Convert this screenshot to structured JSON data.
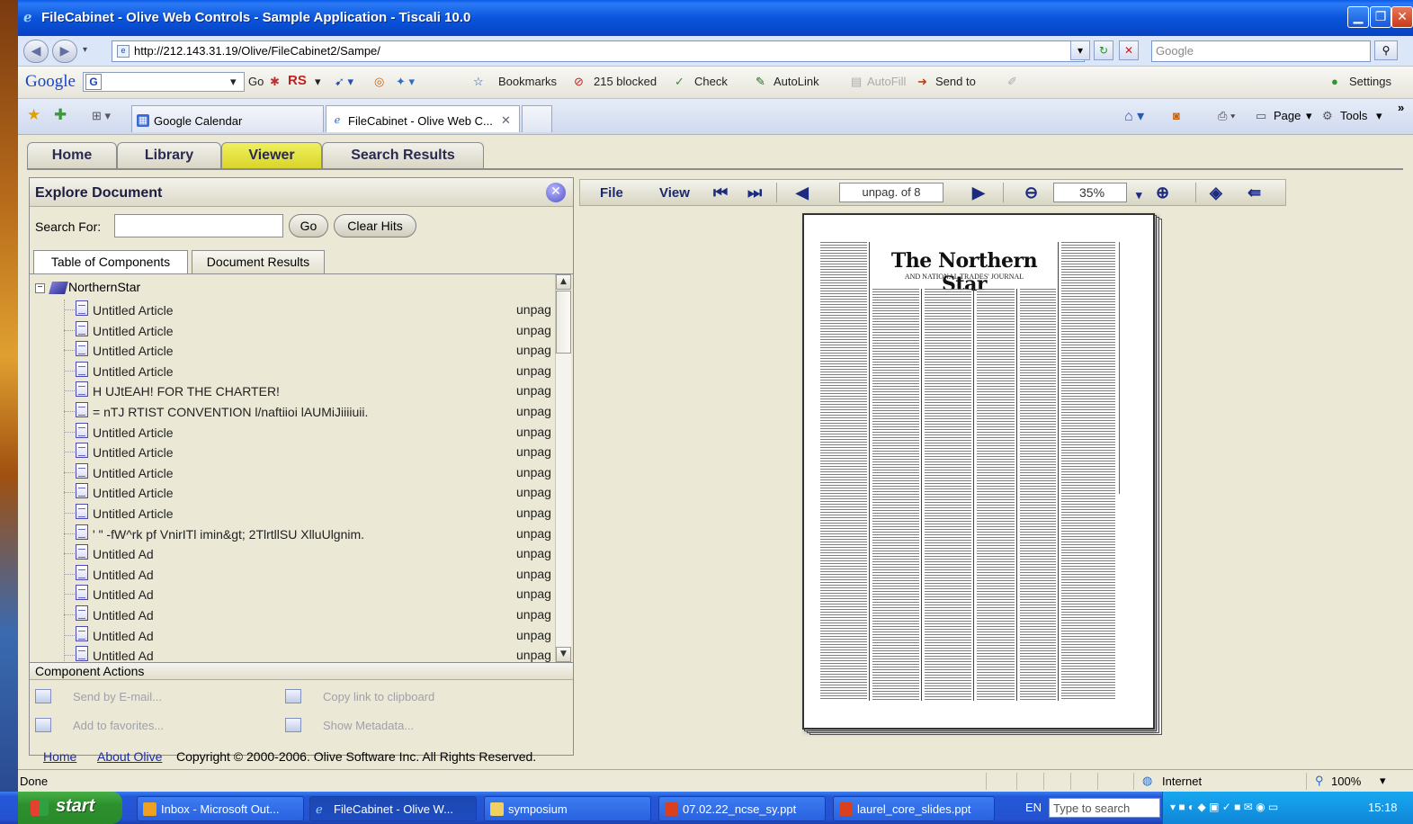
{
  "window": {
    "title": "FileCabinet - Olive Web Controls - Sample Application - Tiscali 10.0"
  },
  "address_bar": {
    "url": "http://212.143.31.19/Olive/FileCabinet2/Sampe/",
    "search_placeholder": "Google"
  },
  "google_toolbar": {
    "logo": "Google",
    "go": "Go",
    "rs": "RS",
    "bookmarks": "Bookmarks",
    "blocked": "215 blocked",
    "check": "Check",
    "autolink": "AutoLink",
    "autofill": "AutoFill",
    "send_to": "Send to",
    "settings": "Settings"
  },
  "browser_tabs": [
    {
      "label": "Google Calendar"
    },
    {
      "label": "FileCabinet - Olive Web C..."
    }
  ],
  "command_bar": {
    "page": "Page",
    "tools": "Tools"
  },
  "app_tabs": [
    {
      "label": "Home"
    },
    {
      "label": "Library"
    },
    {
      "label": "Viewer"
    },
    {
      "label": "Search Results"
    }
  ],
  "explore": {
    "title": "Explore Document",
    "search_label": "Search For:",
    "search_value": "",
    "go": "Go",
    "clear_hits": "Clear Hits",
    "sub_tabs": [
      "Table of Components",
      "Document Results"
    ],
    "root": "NorthernStar",
    "items": [
      {
        "title": "Untitled Article",
        "page": "unpag"
      },
      {
        "title": "Untitled Article",
        "page": "unpag"
      },
      {
        "title": "Untitled Article",
        "page": "unpag"
      },
      {
        "title": "Untitled Article",
        "page": "unpag"
      },
      {
        "title": "H UJtEAH! FOR THE CHARTER!",
        "page": "unpag"
      },
      {
        "title": "= nTJ RTIST CONVENTION l/naftiioi lAUMiJiiiiuii.",
        "page": "unpag"
      },
      {
        "title": "Untitled Article",
        "page": "unpag"
      },
      {
        "title": "Untitled Article",
        "page": "unpag"
      },
      {
        "title": "Untitled Article",
        "page": "unpag"
      },
      {
        "title": "Untitled Article",
        "page": "unpag"
      },
      {
        "title": "Untitled Article",
        "page": "unpag"
      },
      {
        "title": "' \" -fW^rk pf VnirITl imin&gt; 2TlrtllSU XlluUlgnim.",
        "page": "unpag"
      },
      {
        "title": "Untitled Ad",
        "page": "unpag"
      },
      {
        "title": "Untitled Ad",
        "page": "unpag"
      },
      {
        "title": "Untitled Ad",
        "page": "unpag"
      },
      {
        "title": "Untitled Ad",
        "page": "unpag"
      },
      {
        "title": "Untitled Ad",
        "page": "unpag"
      },
      {
        "title": "Untitled Ad",
        "page": "unpag"
      }
    ],
    "actions_title": "Component Actions",
    "actions": {
      "email": "Send by E-mail...",
      "copy_link": "Copy link to clipboard",
      "favorites": "Add to favorites...",
      "metadata": "Show Metadata..."
    }
  },
  "viewer": {
    "file": "File",
    "view": "View",
    "page_value": "unpag. of 8",
    "zoom_value": "35%",
    "masthead": "The Northern Star",
    "masthead_sub": "AND NATIONAL TRADES' JOURNAL"
  },
  "footer": {
    "home": "Home",
    "about": "About Olive",
    "copyright": "Copyright © 2000-2006. Olive Software Inc. All Rights Reserved."
  },
  "status": {
    "text": "Done",
    "zone": "Internet",
    "zoom": "100%"
  },
  "taskbar": {
    "start": "start",
    "tasks": [
      {
        "label": "Inbox - Microsoft Out..."
      },
      {
        "label": "FileCabinet - Olive W..."
      },
      {
        "label": "symposium"
      },
      {
        "label": "07.02.22_ncse_sy.ppt"
      },
      {
        "label": "laurel_core_slides.ppt"
      }
    ],
    "lang": "EN",
    "search_placeholder": "Type to search",
    "clock": "15:18"
  }
}
